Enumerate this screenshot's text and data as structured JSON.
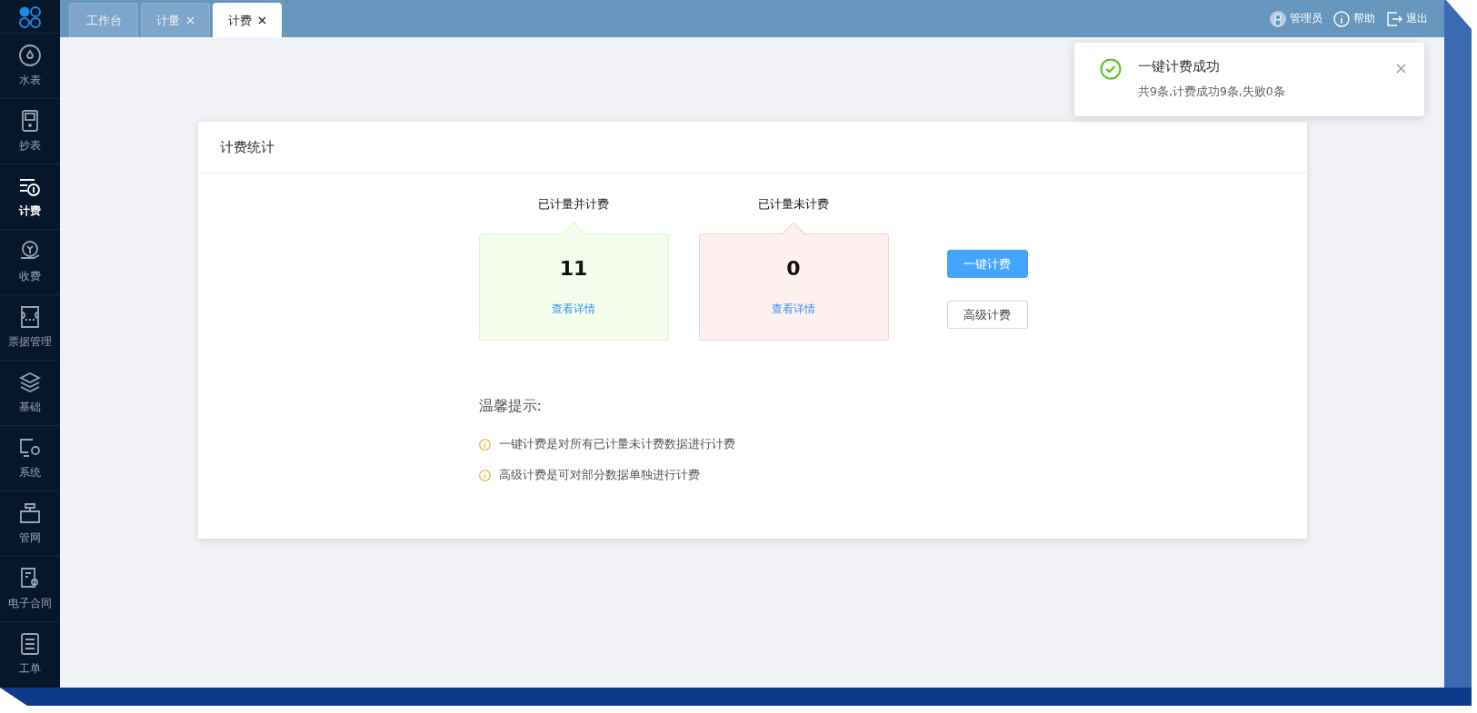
{
  "sidebar": {
    "items": [
      {
        "label": "水表",
        "selected": false
      },
      {
        "label": "抄表",
        "selected": false
      },
      {
        "label": "计费",
        "selected": true
      },
      {
        "label": "收费",
        "selected": false
      },
      {
        "label": "票据管理",
        "selected": false
      },
      {
        "label": "基础",
        "selected": false
      },
      {
        "label": "系统",
        "selected": false
      },
      {
        "label": "管网",
        "selected": false
      },
      {
        "label": "电子合同",
        "selected": false
      },
      {
        "label": "工单",
        "selected": false
      }
    ]
  },
  "tabs": [
    {
      "label": "工作台",
      "closable": false,
      "selected": false
    },
    {
      "label": "计量",
      "closable": true,
      "selected": false
    },
    {
      "label": "计费",
      "closable": true,
      "selected": true
    }
  ],
  "header_actions": [
    {
      "label": "管理员"
    },
    {
      "label": "帮助"
    },
    {
      "label": "退出"
    }
  ],
  "card": {
    "title": "计费统计",
    "stats": [
      {
        "label": "已计量并计费",
        "value": "11",
        "link": "查看详情",
        "color": "#f4fdec"
      },
      {
        "label": "已计量未计费",
        "value": "0",
        "link": "查看详情",
        "color": "#fef0ef"
      }
    ],
    "buttons": [
      {
        "label": "一键计费",
        "kind": "primary"
      },
      {
        "label": "高级计费",
        "kind": "default"
      }
    ],
    "tips": {
      "title": "温馨提示:",
      "items": [
        "一键计费是对所有已计量未计费数据进行计费",
        "高级计费是可对部分数据单独进行计费"
      ]
    }
  },
  "toast": {
    "title": "一键计费成功",
    "message": "共9条,计费成功9条,失败0条"
  }
}
